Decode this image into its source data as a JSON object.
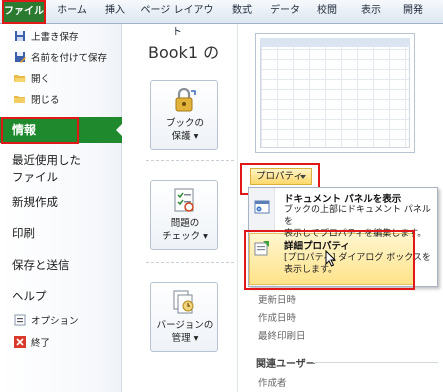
{
  "ribbon": {
    "tabs": [
      "ファイル",
      "ホーム",
      "挿入",
      "ページ レイアウト",
      "数式",
      "データ",
      "校閲",
      "表示",
      "開発"
    ]
  },
  "nav": {
    "save": "上書き保存",
    "save_as": "名前を付けて保存",
    "open": "開く",
    "close": "閉じる",
    "info": "情報",
    "recent_line1": "最近使用した",
    "recent_line2": "ファイル",
    "new": "新規作成",
    "print": "印刷",
    "save_send": "保存と送信",
    "help": "ヘルプ",
    "options": "オプション",
    "exit": "終了"
  },
  "main": {
    "title": "Book1 の",
    "protect_label": "ブックの\n保護 ▾",
    "check_label": "問題の\nチェック ▾",
    "version_label": "バージョンの\n管理 ▾"
  },
  "properties": {
    "button_label": "プロパティ",
    "menu": [
      {
        "title": "ドキュメント パネルを表示",
        "desc": "ブックの上部にドキュメント パネルを\n表示してプロパティを編集します。"
      },
      {
        "title": "詳細プロパティ",
        "desc": "[プロパティ] ダイアログ ボックスを\n表示します。"
      }
    ],
    "dates": [
      "更新日時",
      "作成日時",
      "最終印刷日"
    ],
    "related_users": "関連ユーザー",
    "author": "作成者"
  },
  "colors": {
    "file_tab": "#2a7a2f",
    "active_nav": "#1e8a2d",
    "highlight_box": "#e01818",
    "hover_item": "#ffe38a"
  }
}
